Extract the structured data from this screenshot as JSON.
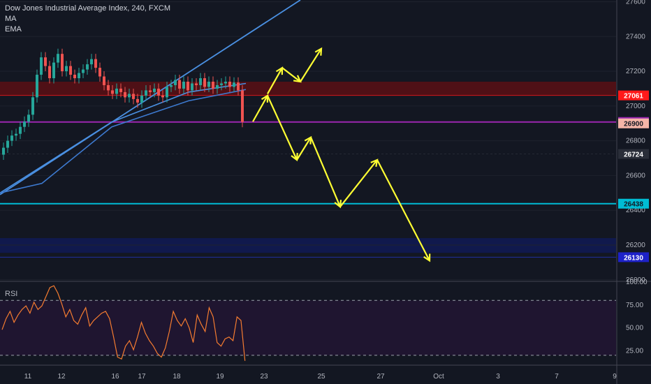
{
  "legend": {
    "title": "Dow Jones Industrial Average Index, 240, FXCM",
    "ma": "MA",
    "ema": "EMA"
  },
  "rsi_label": "RSI",
  "colors": {
    "background": "#131722",
    "up_candle": "#26a69a",
    "down_candle": "#ef5350",
    "ma_line": "#4a90e2",
    "rsi_line": "#f57c30",
    "arrows": "#ffff33"
  },
  "chart_data": [
    {
      "type": "candlestick",
      "title": "Dow Jones Industrial Average Index, 240, FXCM",
      "y_ticks": [
        26000,
        26200,
        26400,
        26600,
        26800,
        27000,
        27200,
        27400,
        27600
      ],
      "y_tick_labels": [
        "26000",
        "26200",
        "26400",
        "26600",
        "26800",
        "27000",
        "27200",
        "27400",
        "27600"
      ],
      "ylim": [
        25995,
        27610
      ],
      "x_ticks": [
        "11",
        "12",
        "16",
        "17",
        "18",
        "19",
        "23",
        "25",
        "27",
        "Oct",
        "3",
        "7",
        "9"
      ],
      "price_levels": [
        {
          "value": 27061,
          "label": "27061",
          "color": "#ff1a1a",
          "text_color": "#ffffff"
        },
        {
          "value": 26908,
          "label": "26908",
          "color": "#9c27b0",
          "text_color": "#ffffff"
        },
        {
          "value": 26900,
          "label": "26900",
          "color": "#f4b5a8",
          "text_color": "#131722"
        },
        {
          "value": 26724,
          "label": "26724",
          "color": "#2a2e39",
          "text_color": "#ffffff"
        },
        {
          "value": 26438,
          "label": "26438",
          "color": "#00bcd4",
          "text_color": "#131722"
        },
        {
          "value": 26130,
          "label": "26130",
          "color": "#1e22c8",
          "text_color": "#ffffff"
        }
      ],
      "zones": [
        {
          "from": 27061,
          "to": 27140,
          "color": "#5a0f14"
        },
        {
          "from": 26155,
          "to": 26240,
          "color": "#101a55"
        }
      ],
      "series": [
        {
          "name": "MA",
          "color": "#4a90e2",
          "x": [
            0,
            160,
            270,
            352
          ],
          "y": [
            26500,
            26908,
            27080,
            27130
          ]
        },
        {
          "name": "EMA",
          "color": "#3d7ad0",
          "x": [
            0,
            60,
            160,
            270,
            352
          ],
          "y": [
            26500,
            26555,
            26880,
            27030,
            27095
          ]
        }
      ],
      "candles_note": "4h candles from Sep 10 to Sep 20"
    },
    {
      "type": "line",
      "title": "RSI",
      "y_ticks": [
        25,
        50,
        75,
        100
      ],
      "y_tick_labels": [
        "25.00",
        "50.00",
        "75.00",
        "100.00"
      ],
      "ylim": [
        10,
        100
      ],
      "bands": [
        20,
        80
      ],
      "values": [
        48,
        60,
        68,
        56,
        64,
        70,
        74,
        66,
        78,
        70,
        74,
        84,
        94,
        96,
        88,
        76,
        62,
        70,
        58,
        54,
        64,
        72,
        52,
        58,
        62,
        66,
        68,
        60,
        40,
        18,
        16,
        30,
        36,
        26,
        40,
        56,
        44,
        36,
        30,
        22,
        18,
        28,
        46,
        68,
        58,
        52,
        60,
        50,
        34,
        64,
        54,
        46,
        72,
        62,
        34,
        30,
        38,
        40,
        36,
        62,
        58,
        14
      ]
    }
  ]
}
